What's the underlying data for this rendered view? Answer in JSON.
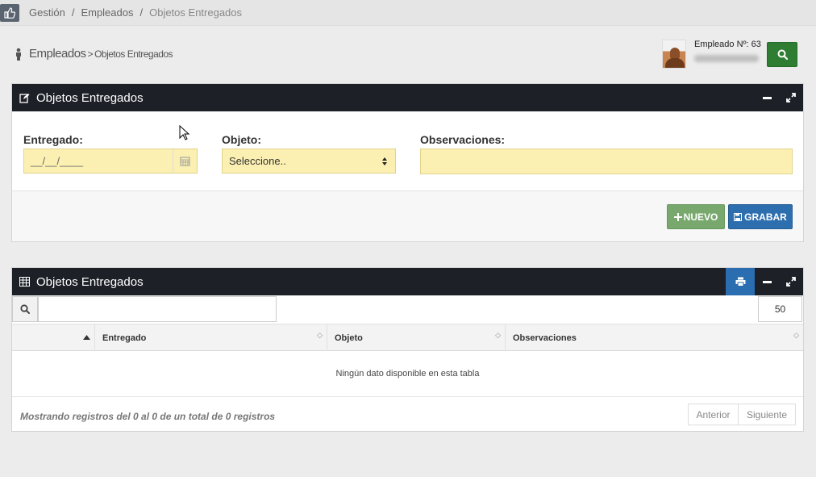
{
  "breadcrumb": {
    "items": [
      "Gestión",
      "Empleados",
      "Objetos Entregados"
    ],
    "separator": "/"
  },
  "page_heading": {
    "section": "Empleados",
    "separator": ">",
    "page": "Objetos Entregados"
  },
  "employee": {
    "label": "Empleado Nº: 63"
  },
  "form_panel": {
    "title": "Objetos Entregados",
    "fields": {
      "entregado": {
        "label": "Entregado:",
        "value": "__/__/____"
      },
      "objeto": {
        "label": "Objeto:",
        "value": "Seleccione.."
      },
      "observaciones": {
        "label": "Observaciones:",
        "value": ""
      }
    },
    "buttons": {
      "new": "NUEVO",
      "save": "GRABAR"
    }
  },
  "table_panel": {
    "title": "Objetos Entregados",
    "search_value": "",
    "page_length": "50",
    "columns": [
      "Entregado",
      "Objeto",
      "Observaciones"
    ],
    "empty_message": "Ningún dato disponible en esta tabla",
    "info": "Mostrando registros del 0 al 0 de un total de 0 registros",
    "pager": {
      "prev": "Anterior",
      "next": "Siguiente"
    }
  },
  "colors": {
    "header_dark": "#1d2027",
    "input_yellow": "#fbf0b2",
    "green": "#2e7d32",
    "blue": "#2d6fae"
  }
}
